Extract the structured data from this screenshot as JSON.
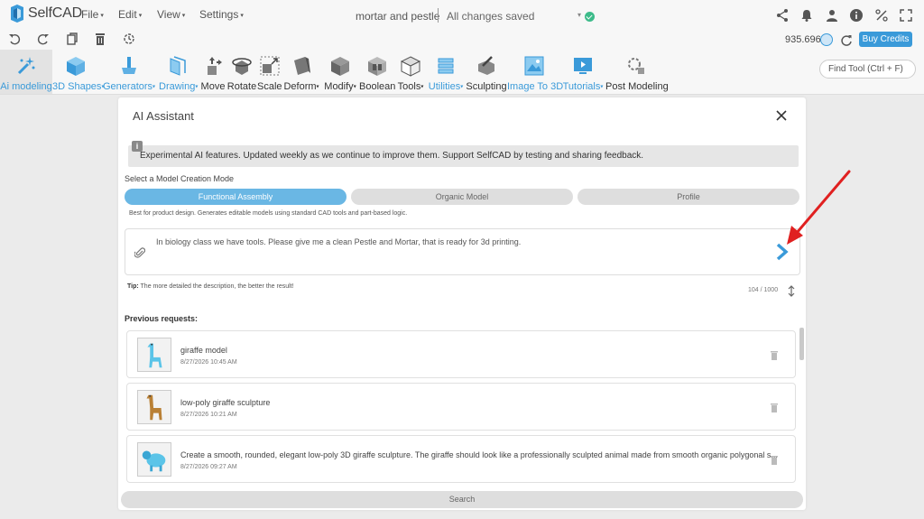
{
  "app": {
    "name": "SelfCAD"
  },
  "menu": [
    "File",
    "Edit",
    "View",
    "Settings"
  ],
  "document": {
    "title": "mortar and pestle",
    "status": "All changes saved"
  },
  "topbar_icons": [
    "share-icon",
    "bell-icon",
    "user-icon",
    "info-icon",
    "units-icon",
    "fullscreen-icon"
  ],
  "subbar": {
    "icons": [
      "undo-icon",
      "redo-icon",
      "copy-icon",
      "delete-icon",
      "history-icon"
    ],
    "credits": "935.696",
    "buy_label": "Buy Credits"
  },
  "toolbar": {
    "tools": [
      {
        "label": "Ai modeling",
        "blue": true,
        "caret": false,
        "icon": "ai-modeling-icon"
      },
      {
        "label": "3D Shapes",
        "blue": true,
        "caret": true,
        "icon": "cube-icon"
      },
      {
        "label": "Generators",
        "blue": true,
        "caret": true,
        "icon": "generator-icon"
      },
      {
        "label": "Drawing",
        "blue": true,
        "caret": true,
        "icon": "drawing-icon"
      },
      {
        "label": "Move",
        "blue": false,
        "caret": false,
        "icon": "move-icon"
      },
      {
        "label": "Rotate",
        "blue": false,
        "caret": false,
        "icon": "rotate-icon"
      },
      {
        "label": "Scale",
        "blue": false,
        "caret": false,
        "icon": "scale-icon"
      },
      {
        "label": "Deform",
        "blue": false,
        "caret": true,
        "icon": "deform-icon"
      },
      {
        "label": "Modify",
        "blue": false,
        "caret": true,
        "icon": "modify-icon"
      },
      {
        "label": "Boolean",
        "blue": false,
        "caret": false,
        "icon": "boolean-icon"
      },
      {
        "label": "Tools",
        "blue": false,
        "caret": true,
        "icon": "tools-icon"
      },
      {
        "label": "Utilities",
        "blue": true,
        "caret": true,
        "icon": "utilities-icon"
      },
      {
        "label": "Sculpting",
        "blue": false,
        "caret": false,
        "icon": "sculpting-icon"
      },
      {
        "label": "Image To 3D",
        "blue": true,
        "caret": false,
        "icon": "image-to-3d-icon"
      },
      {
        "label": "Tutorials",
        "blue": true,
        "caret": true,
        "icon": "tutorials-icon"
      },
      {
        "label": "Post Modeling",
        "blue": false,
        "caret": false,
        "icon": "post-modeling-icon"
      }
    ],
    "find_placeholder": "Find Tool (Ctrl + F)"
  },
  "modal": {
    "title": "AI Assistant",
    "notice": "Experimental AI features. Updated weekly as we continue to improve them. Support SelfCAD by testing and sharing feedback.",
    "mode_label": "Select a Model Creation Mode",
    "modes": [
      "Functional Assembly",
      "Organic Model",
      "Profile"
    ],
    "active_mode": "Functional Assembly",
    "mode_help": "Best for product design. Generates editable models using standard CAD tools and part-based logic.",
    "prompt": "In biology class we have tools. Please give me a clean Pestle and Mortar, that is ready for 3d printing.",
    "tip_label": "Tip:",
    "tip_text": "The more detailed the description, the better the result!",
    "counter": "104 / 1000",
    "previous_label": "Previous requests:",
    "requests": [
      {
        "title": "giraffe model",
        "date": "8/27/2026 10:45 AM",
        "thumb": "giraffe-blue-icon"
      },
      {
        "title": "low-poly giraffe sculpture",
        "date": "8/27/2026 10:21 AM",
        "thumb": "giraffe-brown-icon"
      },
      {
        "title": "Create a smooth, rounded, elegant low-poly 3D giraffe sculpture. The giraffe should look like a professionally sculpted animal made from smooth organic polygonal s...",
        "date": "8/27/2026 09:27 AM",
        "thumb": "sheep-blue-icon"
      }
    ],
    "search_label": "Search"
  },
  "colors": {
    "accent": "#3a9ad9",
    "active_mode": "#6ab7e4",
    "annotation": "#e02020"
  }
}
